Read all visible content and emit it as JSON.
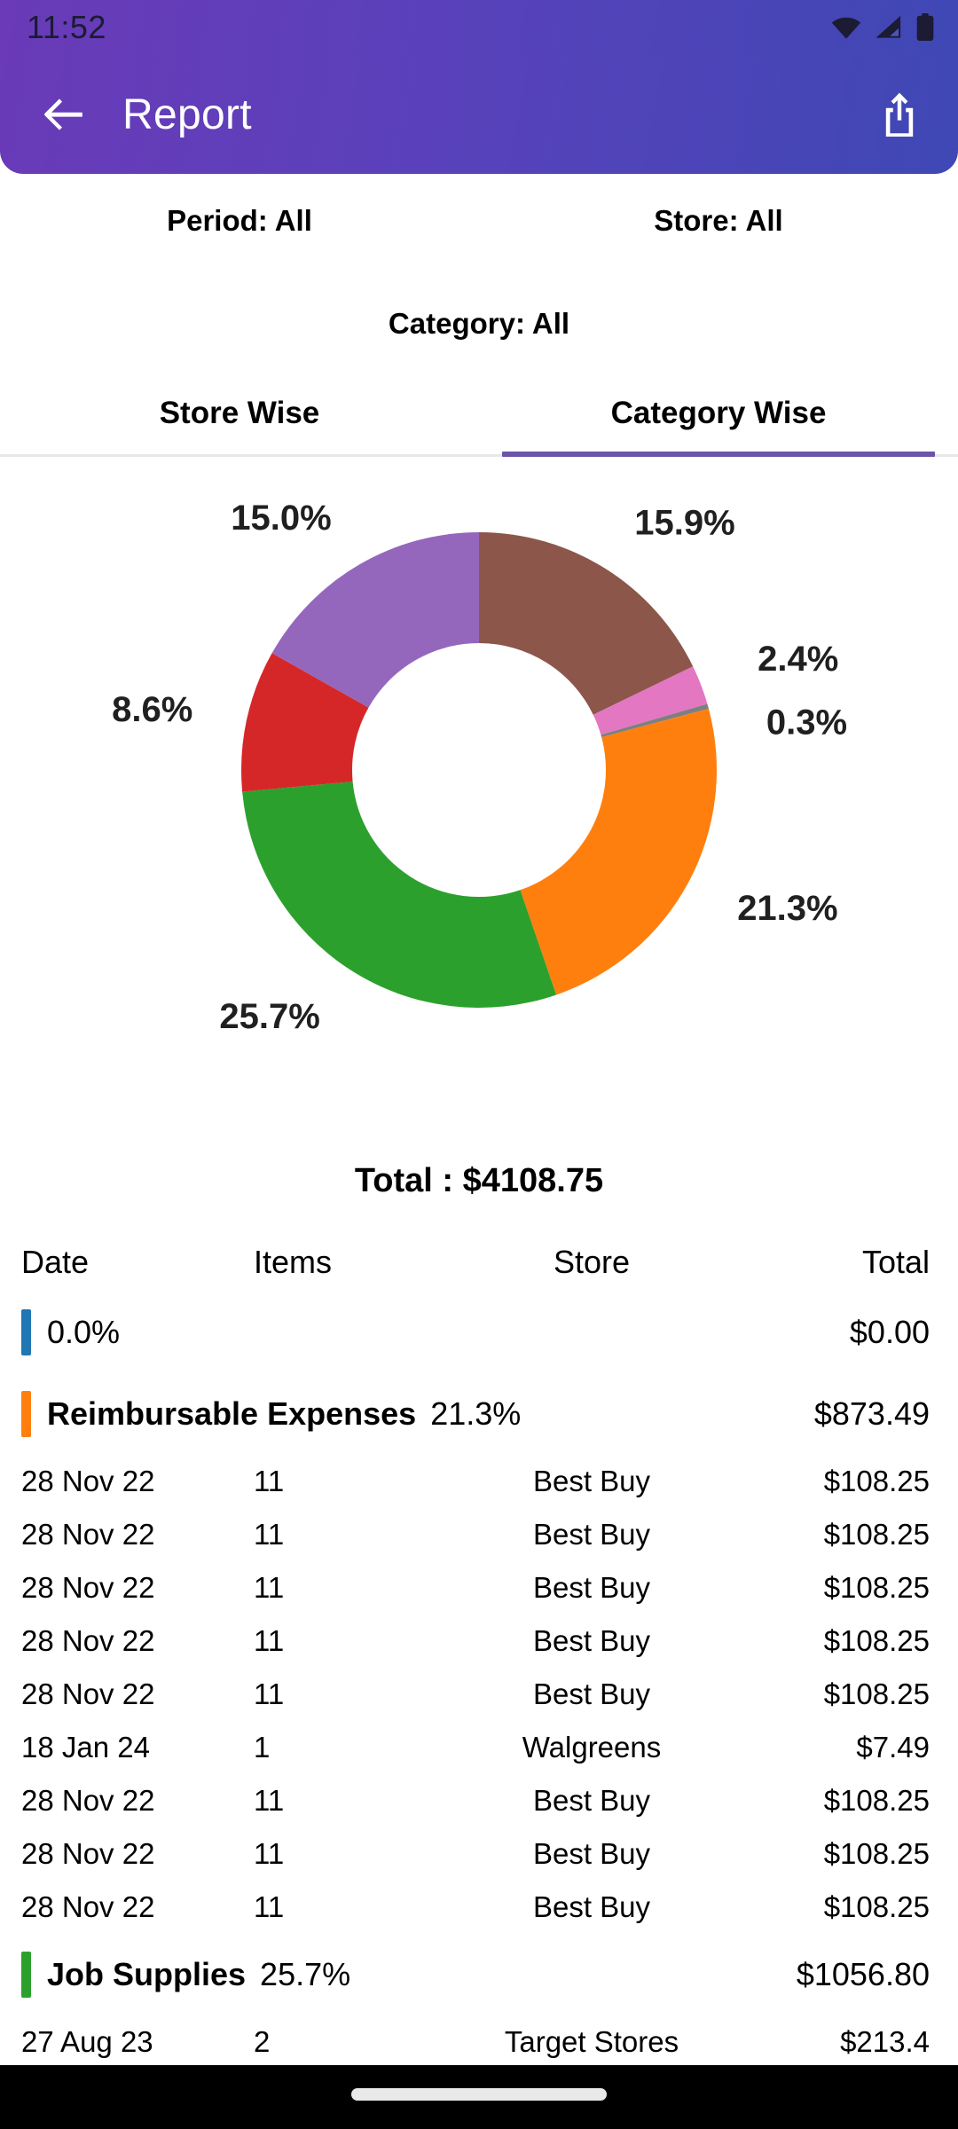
{
  "status_bar": {
    "time": "11:52",
    "icons": [
      "wifi-icon",
      "cell-signal-icon",
      "battery-icon"
    ],
    "icon_color": "#1b1b33"
  },
  "header": {
    "title": "Report",
    "back_icon": "arrow-left-icon",
    "share_icon": "share-icon",
    "gradient_from": "#6a3ab8",
    "gradient_to": "#3f48b5"
  },
  "filters": {
    "period": "Period: All",
    "store": "Store: All",
    "category": "Category: All"
  },
  "tabs": {
    "active_index": 1,
    "indicator_color": "#6c55a8",
    "items": [
      {
        "label": "Store Wise"
      },
      {
        "label": "Category Wise"
      }
    ]
  },
  "chart_data": {
    "type": "pie",
    "title": "",
    "donut": true,
    "legend": "none",
    "start_angle_deg": -90,
    "direction": "clockwise",
    "labels": [
      "15.9%",
      "2.4%",
      "0.3%",
      "21.3%",
      "25.7%",
      "8.6%",
      "15.0%"
    ],
    "values": [
      15.9,
      2.4,
      0.3,
      21.3,
      25.7,
      8.6,
      15.0
    ],
    "colors": [
      "#8c564b",
      "#e377c2",
      "#7f7f7f",
      "#ff7f0e",
      "#2ca02c",
      "#d62728",
      "#9467bd"
    ],
    "categories": [
      "",
      "",
      "",
      "Reimbursable Expenses",
      "Job Supplies",
      "",
      ""
    ]
  },
  "total": {
    "label": "Total : $4108.75"
  },
  "table": {
    "columns": [
      "Date",
      "Items",
      "Store",
      "Total"
    ],
    "groups": [
      {
        "color": "#1f77b4",
        "name": "",
        "pct": "0.0%",
        "total": "$0.00",
        "rows": []
      },
      {
        "color": "#ff7f0e",
        "name": "Reimbursable Expenses",
        "pct": "21.3%",
        "total": "$873.49",
        "rows": [
          {
            "date": "28 Nov 22",
            "items": "11",
            "store": "Best Buy",
            "total": "$108.25"
          },
          {
            "date": "28 Nov 22",
            "items": "11",
            "store": "Best Buy",
            "total": "$108.25"
          },
          {
            "date": "28 Nov 22",
            "items": "11",
            "store": "Best Buy",
            "total": "$108.25"
          },
          {
            "date": "28 Nov 22",
            "items": "11",
            "store": "Best Buy",
            "total": "$108.25"
          },
          {
            "date": "28 Nov 22",
            "items": "11",
            "store": "Best Buy",
            "total": "$108.25"
          },
          {
            "date": "18 Jan 24",
            "items": "1",
            "store": "Walgreens",
            "total": "$7.49"
          },
          {
            "date": "28 Nov 22",
            "items": "11",
            "store": "Best Buy",
            "total": "$108.25"
          },
          {
            "date": "28 Nov 22",
            "items": "11",
            "store": "Best Buy",
            "total": "$108.25"
          },
          {
            "date": "28 Nov 22",
            "items": "11",
            "store": "Best Buy",
            "total": "$108.25"
          }
        ]
      },
      {
        "color": "#2ca02c",
        "name": "Job Supplies",
        "pct": "25.7%",
        "total": "$1056.80",
        "rows": [
          {
            "date": "27 Aug 23",
            "items": "2",
            "store": "Target Stores",
            "total": "$213.4"
          }
        ]
      }
    ]
  }
}
